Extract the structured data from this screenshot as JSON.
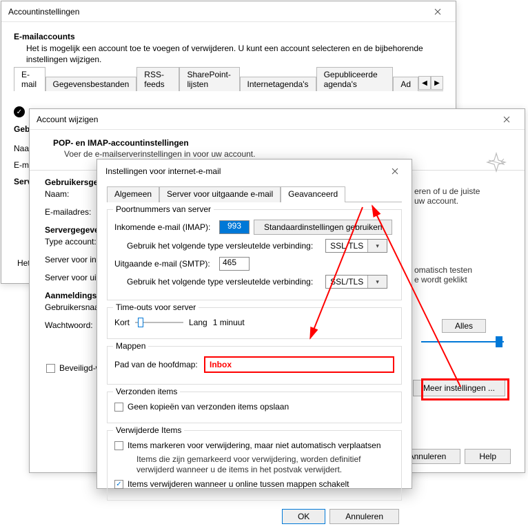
{
  "win1": {
    "title": "Accountinstellingen",
    "section_title": "E-mailaccounts",
    "section_body": "Het is mogelijk een account toe te voegen of verwijderen. U kunt een account selecteren en de bijbehorende instellingen wijzigen.",
    "tabs": [
      "E-mail",
      "Gegevensbestanden",
      "RSS-feeds",
      "SharePoint-lijsten",
      "Internetagenda's",
      "Gepubliceerde agenda's",
      "Ad"
    ],
    "name_lbl": "Naa",
    "gebruikers_header": "Gebruikersgeg",
    "naam_lbl": "Naam:",
    "email_lbl": "E-mailadres:",
    "server_header": "Servergegeven",
    "type_lbl": "Type account:",
    "in_lbl": "Server voor ink",
    "out_lbl": "Server voor uit",
    "login_header": "Aanmeldingsg",
    "user_lbl": "Gebruikersnaa",
    "pass_lbl": "Wachtwoord:",
    "help_text": "Het",
    "secure_lbl": "Beveiligd-w"
  },
  "win2": {
    "title": "Account wijzigen",
    "head_title": "POP- en IMAP-accountinstellingen",
    "head_sub": "Voer de e-mailserverinstellingen in voor uw account.",
    "note_line1": "eren of u de juiste",
    "note_line2": "uw account.",
    "auto_line1": "omatisch testen",
    "auto_line2": "e wordt geklikt",
    "alles_btn": "Alles",
    "meer_btn": "Meer instellingen ...",
    "annuleren": "Annuleren",
    "help": "Help"
  },
  "win3": {
    "title": "Instellingen voor internet-e-mail",
    "tabs": [
      "Algemeen",
      "Server voor uitgaande e-mail",
      "Geavanceerd"
    ],
    "ports_legend": "Poortnummers van server",
    "in_lbl": "Inkomende e-mail (IMAP):",
    "in_val": "993",
    "std_btn": "Standaardinstellingen gebruiken",
    "enc_lbl": "Gebruik het volgende type versleutelde verbinding:",
    "enc_val": "SSL/TLS",
    "out_lbl": "Uitgaande e-mail (SMTP):",
    "out_val": "465",
    "to_legend": "Time-outs voor server",
    "kort": "Kort",
    "lang": "Lang",
    "to_val": "1 minuut",
    "folders_legend": "Mappen",
    "root_lbl": "Pad van de hoofdmap:",
    "root_val": "Inbox",
    "sent_legend": "Verzonden items",
    "sent_chk": "Geen kopieën van verzonden items opslaan",
    "del_legend": "Verwijderde Items",
    "del_chk1": "Items markeren voor verwijdering, maar niet automatisch verplaatsen",
    "del_note": "Items die zijn gemarkeerd voor verwijdering, worden definitief verwijderd wanneer u de items in het postvak verwijdert.",
    "del_chk2": "Items verwijderen wanneer u online tussen mappen schakelt",
    "ok": "OK",
    "cancel": "Annuleren"
  }
}
